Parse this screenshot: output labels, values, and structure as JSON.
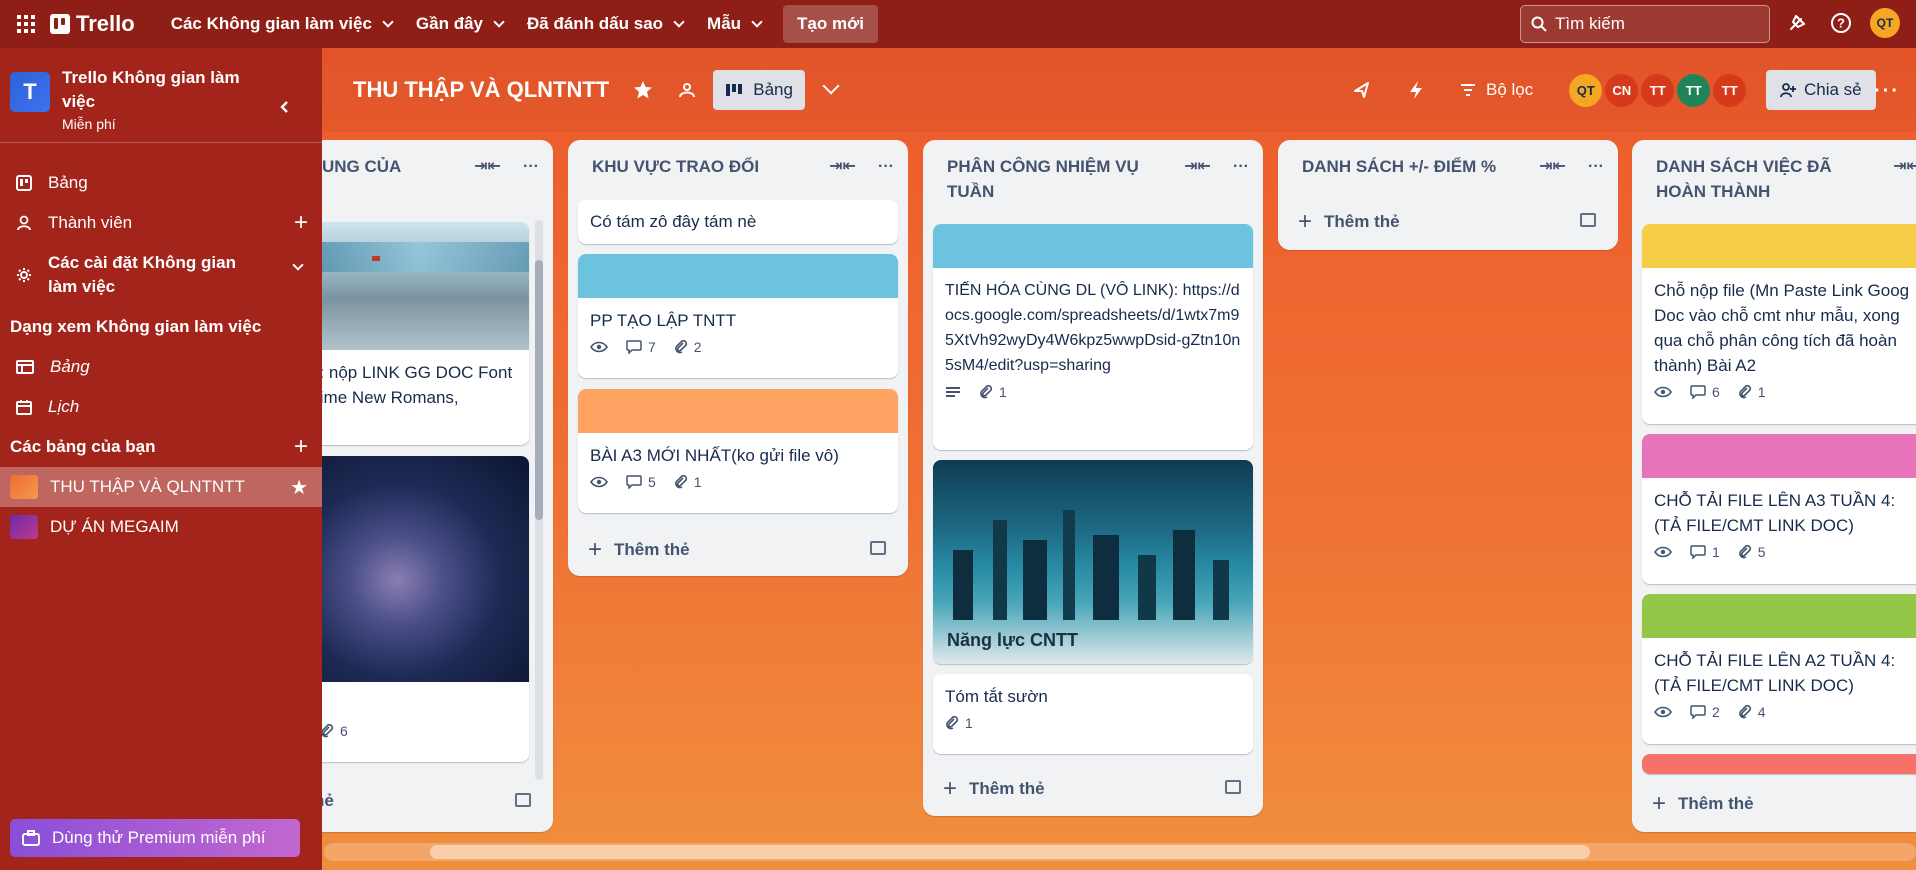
{
  "topbar": {
    "app_name": "Trello",
    "nav": [
      "Các Không gian làm việc",
      "Gần đây",
      "Đã đánh dấu sao",
      "Mẫu"
    ],
    "create_label": "Tạo mới",
    "search_placeholder": "Tìm kiếm",
    "user_initials": "QT"
  },
  "sidebar": {
    "workspace_name": "Trello Không gian làm việc",
    "workspace_plan": "Miễn phí",
    "workspace_initial": "T",
    "items": [
      "Bảng",
      "Thành viên",
      "Các cài đặt Không gian làm việc"
    ],
    "views_heading": "Dạng xem Không gian làm việc",
    "views": [
      "Bảng",
      "Lịch"
    ],
    "boards_heading": "Các bảng của bạn",
    "boards": [
      "THU THẬP VÀ QLNTNTT",
      "DỰ ÁN MEGAIM"
    ],
    "premium_label": "Dùng thử Premium miễn phí"
  },
  "board": {
    "title": "THU THẬP VÀ QLNTNTT",
    "view_label": "Bảng",
    "filter_label": "Bộ lọc",
    "share_label": "Chia sẻ",
    "members": [
      "QT",
      "CN",
      "TT",
      "TT",
      "TT"
    ]
  },
  "lists": [
    {
      "title": "UNG CỦA",
      "cards": [
        {
          "title": "g: nộp LINK GG DOC Font Time New Romans,"
        },
        {
          "title": "ề",
          "attachments": "6"
        }
      ],
      "add_label": "hẻ"
    },
    {
      "title": "KHU VỰC TRAO ĐỔI",
      "cards": [
        {
          "title": "Có tám zô đây tám nè"
        },
        {
          "title": "PP TẠO LẬP TNTT",
          "comments": "7",
          "attachments": "2"
        },
        {
          "title": "BÀI A3 MỚI NHẤT(ko gửi file vô)",
          "comments": "5",
          "attachments": "1"
        }
      ],
      "add_label": "Thêm thẻ"
    },
    {
      "title": "PHÂN CÔNG NHIỆM VỤ TUẦN",
      "cards": [
        {
          "title": "TIẾN HÓA CÙNG DL (VÔ LINK): https://docs.google.com/spreadsheets/d/1wtx7m95XtVh92wyDy4W6kpz5wwpDsid-gZtn10n5sM4/edit?usp=sharing",
          "attachments": "1"
        },
        {
          "title": "Năng lực CNTT"
        },
        {
          "title": "Tóm tắt sườn",
          "attachments": "1"
        }
      ],
      "add_label": "Thêm thẻ"
    },
    {
      "title": "DANH SÁCH +/- ĐIỂM %",
      "cards": [],
      "add_label": "Thêm thẻ"
    },
    {
      "title": "DANH SÁCH VIỆC ĐÃ HOÀN THÀNH",
      "cards": [
        {
          "title": "Chỗ nộp file (Mn Paste Link Goog Doc vào chỗ cmt như mẫu, xong qua chỗ phân công tích đã hoàn thành) Bài A2",
          "comments": "6",
          "attachments": "1"
        },
        {
          "title": "CHỖ TẢI FILE LÊN A3 TUẦN 4: (TẢ FILE/CMT LINK DOC)",
          "comments": "1",
          "attachments": "5"
        },
        {
          "title": "CHỖ TẢI FILE LÊN A2 TUẦN 4: (TẢ FILE/CMT LINK DOC)",
          "comments": "2",
          "attachments": "4"
        }
      ],
      "add_label": "Thêm thẻ"
    }
  ],
  "colors": {
    "topbar": "#8f1f16",
    "sidebar": "#a2241a",
    "cover_blue": "#6cc3e0",
    "cover_orange": "#fea362",
    "cover_yellow": "#f5cd47",
    "cover_pink": "#e774bb",
    "cover_green": "#94c748",
    "cover_red": "#f87168"
  }
}
